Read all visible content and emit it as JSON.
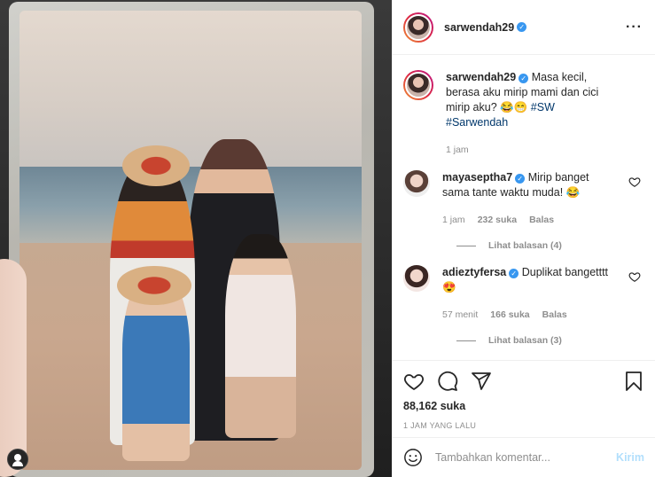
{
  "post": {
    "username": "sarwendah29",
    "verified": true,
    "more_icon": "more-horizontal-icon",
    "caption": {
      "username": "sarwendah29",
      "text": "Masa kecil, berasa aku mirip mami dan cici mirip aku?",
      "emojis": "😂😁",
      "hashtags": "#SW #Sarwendah",
      "time": "1 jam"
    }
  },
  "comments": [
    {
      "username": "mayaseptha7",
      "verified": true,
      "text": "Mirip banget sama tante waktu muda!",
      "emoji": "😂",
      "time": "1 jam",
      "likes": "232 suka",
      "reply_label": "Balas",
      "view_replies": "Lihat balasan (4)"
    },
    {
      "username": "adieztyfersa",
      "verified": true,
      "text": "Duplikat bangetttt",
      "emoji": "😍",
      "time": "57 menit",
      "likes": "166 suka",
      "reply_label": "Balas",
      "view_replies": "Lihat balasan (3)"
    }
  ],
  "actions": {
    "like_icon": "heart-icon",
    "comment_icon": "comment-icon",
    "share_icon": "share-icon",
    "save_icon": "bookmark-icon",
    "likes": "88,162 suka",
    "timestamp": "1 JAM YANG LALU"
  },
  "add_comment": {
    "emoji_icon": "emoji-icon",
    "placeholder": "Tambahkan komentar...",
    "post_label": "Kirim"
  },
  "colors": {
    "verified": "#3897f0",
    "post_button_disabled": "#b2dffc",
    "meta_text": "#8e8e8e",
    "hashtag": "#00376b"
  }
}
